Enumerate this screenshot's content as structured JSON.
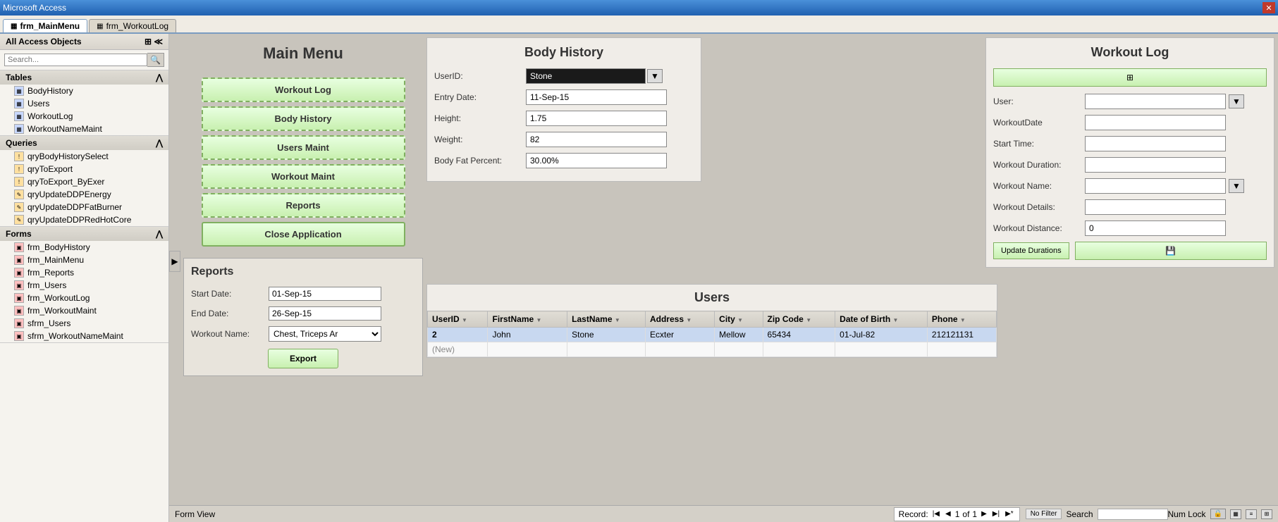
{
  "titleBar": {
    "title": "Microsoft Access",
    "closeLabel": "✕"
  },
  "tabs": [
    {
      "id": "frm_MainMenu",
      "label": "frm_MainMenu",
      "active": true
    },
    {
      "id": "frm_WorkoutLog",
      "label": "frm_WorkoutLog",
      "active": false
    }
  ],
  "sidebar": {
    "headerLabel": "All Access Objects",
    "searchPlaceholder": "Search...",
    "sections": [
      {
        "title": "Tables",
        "items": [
          {
            "name": "BodyHistory",
            "type": "table"
          },
          {
            "name": "Users",
            "type": "table"
          },
          {
            "name": "WorkoutLog",
            "type": "table"
          },
          {
            "name": "WorkoutNameMaint",
            "type": "table"
          }
        ]
      },
      {
        "title": "Queries",
        "items": [
          {
            "name": "qryBodyHistorySelect",
            "type": "query"
          },
          {
            "name": "qryToExport",
            "type": "query"
          },
          {
            "name": "qryToExport_ByExer",
            "type": "query"
          },
          {
            "name": "qryUpdateDDPEnergy",
            "type": "query"
          },
          {
            "name": "qryUpdateDDPFatBurner",
            "type": "query"
          },
          {
            "name": "qryUpdateDDPRedHotCore",
            "type": "query"
          }
        ]
      },
      {
        "title": "Forms",
        "items": [
          {
            "name": "frm_BodyHistory",
            "type": "form"
          },
          {
            "name": "frm_MainMenu",
            "type": "form"
          },
          {
            "name": "frm_Reports",
            "type": "form"
          },
          {
            "name": "frm_Users",
            "type": "form"
          },
          {
            "name": "frm_WorkoutLog",
            "type": "form"
          },
          {
            "name": "frm_WorkoutMaint",
            "type": "form"
          },
          {
            "name": "sfrm_Users",
            "type": "form"
          },
          {
            "name": "sfrm_WorkoutNameMaint",
            "type": "form"
          }
        ]
      }
    ]
  },
  "mainMenu": {
    "title": "Main Menu",
    "buttons": [
      {
        "id": "workout-log",
        "label": "Workout Log"
      },
      {
        "id": "body-history",
        "label": "Body History"
      },
      {
        "id": "users-maint",
        "label": "Users Maint"
      },
      {
        "id": "workout-maint",
        "label": "Workout Maint"
      },
      {
        "id": "reports",
        "label": "Reports"
      },
      {
        "id": "close-application",
        "label": "Close Application"
      }
    ]
  },
  "reportsPanel": {
    "title": "Reports",
    "fields": {
      "startDateLabel": "Start Date:",
      "startDateValue": "01-Sep-15",
      "endDateLabel": "End Date:",
      "endDateValue": "26-Sep-15",
      "workoutNameLabel": "Workout Name:",
      "workoutNameValue": "Chest, Triceps Ar"
    },
    "exportButton": "Export"
  },
  "bodyHistory": {
    "title": "Body History",
    "fields": {
      "userIdLabel": "UserID:",
      "userIdValue": "Stone",
      "entryDateLabel": "Entry Date:",
      "entryDateValue": "11-Sep-15",
      "heightLabel": "Height:",
      "heightValue": "1.75",
      "weightLabel": "Weight:",
      "weightValue": "82",
      "bodyFatLabel": "Body Fat Percent:",
      "bodyFatValue": "30.00%"
    }
  },
  "workoutLog": {
    "title": "Workout Log",
    "navButtonLabel": "⊞",
    "fields": {
      "userLabel": "User:",
      "userValue": "",
      "workoutDateLabel": "WorkoutDate",
      "workoutDateValue": "",
      "startTimeLabel": "Start Time:",
      "startTimeValue": "",
      "workoutDurationLabel": "Workout Duration:",
      "workoutDurationValue": "",
      "workoutNameLabel": "Workout Name:",
      "workoutNameValue": "",
      "workoutDetailsLabel": "Workout Details:",
      "workoutDetailsValue": "",
      "workoutDistanceLabel": "Workout Distance:",
      "workoutDistanceValue": "0"
    },
    "updateDurationsLabel": "Update Durations",
    "saveIconLabel": "💾"
  },
  "usersTable": {
    "title": "Users",
    "columns": [
      {
        "id": "UserID",
        "label": "UserID"
      },
      {
        "id": "FirstName",
        "label": "FirstName"
      },
      {
        "id": "LastName",
        "label": "LastName"
      },
      {
        "id": "Address",
        "label": "Address"
      },
      {
        "id": "City",
        "label": "City"
      },
      {
        "id": "ZipCode",
        "label": "Zip Code"
      },
      {
        "id": "DateOfBirth",
        "label": "Date of Birth"
      },
      {
        "id": "Phone",
        "label": "Phone"
      }
    ],
    "rows": [
      {
        "UserID": "2",
        "FirstName": "John",
        "LastName": "Stone",
        "Address": "Ecxter",
        "City": "Mellow",
        "ZipCode": "65434",
        "DateOfBirth": "01-Jul-82",
        "Phone": "212121131",
        "selected": true
      }
    ],
    "newRowLabel": "(New)"
  },
  "statusBar": {
    "formViewLabel": "Form View",
    "recordLabel": "Record:",
    "recordCurrent": "1",
    "recordTotal": "1",
    "noFilterLabel": "No Filter",
    "searchLabel": "Search",
    "numLockLabel": "Num Lock"
  }
}
